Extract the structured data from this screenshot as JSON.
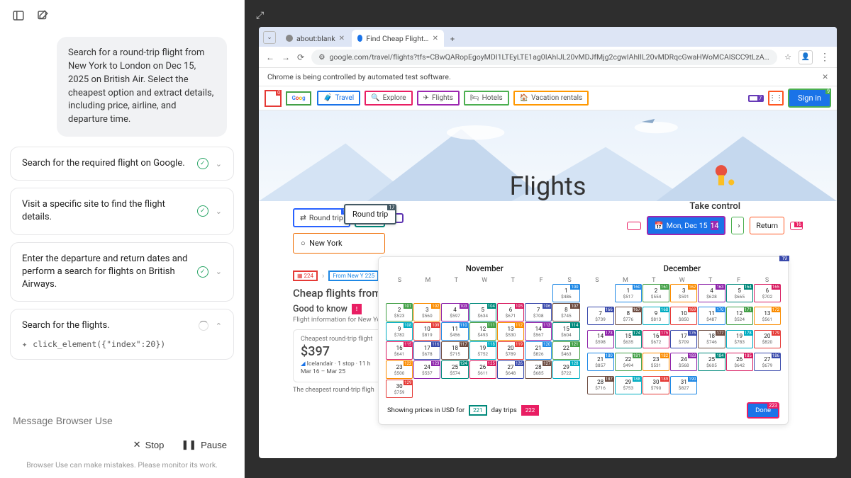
{
  "left": {
    "prompt": "Search for a round-trip flight from New York to London on Dec 15, 2025 on British Air. Select the cheapest option and extract details, including price, airline, and departure time.",
    "tasks": [
      {
        "title": "Search for the required flight on Google.",
        "status": "done"
      },
      {
        "title": "Visit a specific site to find the flight details.",
        "status": "done"
      },
      {
        "title": "Enter the departure and return dates and perform a search for flights on British Airways.",
        "status": "done"
      },
      {
        "title": "Search for the flights.",
        "status": "running",
        "code": "click_element({\"index\":20})"
      }
    ],
    "input_placeholder": "Message Browser Use",
    "stop": "Stop",
    "pause": "Pause",
    "footer": "Browser Use can make mistakes. Please monitor its work."
  },
  "browser": {
    "tabs": [
      {
        "label": "about:blank"
      },
      {
        "label": "Find Cheap Flights from N"
      }
    ],
    "url": "google.com/travel/flights?tfs=CBwQARopEgoyMDI1LTEyLTE1ag0IAhIJL20vMDJfMjg2cgwIAhIIL20vMDRqcGwaHWoMCAISCC9tLzA…",
    "infobar": "Chrome is being controlled by automated test software."
  },
  "gf": {
    "nav": {
      "travel": "Travel",
      "explore": "Explore",
      "flights": "Flights",
      "hotels": "Hotels",
      "rentals": "Vacation rentals",
      "signin": "Sign in"
    },
    "hero_title": "Flights",
    "search": {
      "roundtrip": "Round trip",
      "pax": "1",
      "roundtrip_overlay": "Round trip",
      "origin": "New York",
      "take_control": "Take control",
      "mon_dec": "Mon, Dec 15",
      "return": "Return"
    },
    "below": {
      "from_ny": "From New Y",
      "cheap_title": "Cheap flights from",
      "good": "Good to know",
      "good_sub": "Flight information for New York t",
      "cheapest_lbl": "Cheapest round-trip flight",
      "price": "$397",
      "meta1": "Icelandair · 1 stop · 11 h",
      "meta2": "Mar 16 – Mar 25",
      "foot": "The cheapest round-trip fligh"
    },
    "calendar": {
      "months": [
        "November",
        "December"
      ],
      "dows": [
        "S",
        "M",
        "T",
        "W",
        "T",
        "F",
        "S"
      ],
      "foot_prefix": "Showing prices in USD for",
      "foot_suffix": "day trips",
      "done": "Done"
    }
  }
}
